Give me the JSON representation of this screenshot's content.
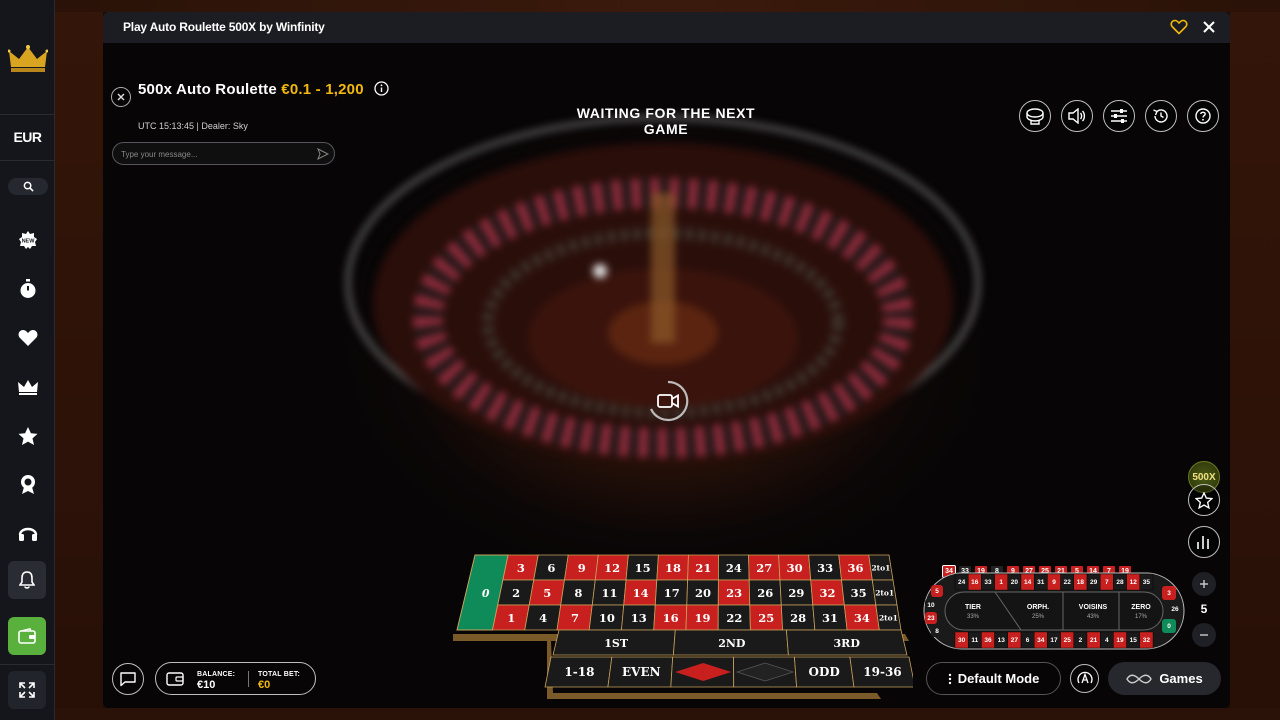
{
  "sidebar": {
    "currency": "EUR",
    "icons": [
      "crown-logo-icon",
      "search-icon",
      "new-games-icon",
      "stopwatch-icon",
      "heart-icon",
      "crown-icon",
      "star-icon",
      "trophy-icon",
      "headset-icon",
      "bell-icon",
      "wallet-icon",
      "fullscreen-icon"
    ]
  },
  "window": {
    "title": "Play Auto Roulette 500X by Winfinity"
  },
  "game": {
    "name": "500x Auto Roulette",
    "bet_limits": "€0.1 - 1,200",
    "meta": "UTC 15:13:45 | Dealer: Sky",
    "status": "WAITING FOR THE NEXT GAME"
  },
  "chat": {
    "placeholder": "Type your message..."
  },
  "multiplier_label": "500X",
  "recent_results": [
    {
      "n": "34",
      "c": "red"
    },
    {
      "n": "33",
      "c": "black"
    },
    {
      "n": "19",
      "c": "red"
    },
    {
      "n": "8",
      "c": "black"
    },
    {
      "n": "9",
      "c": "red"
    },
    {
      "n": "27",
      "c": "red"
    },
    {
      "n": "25",
      "c": "red"
    },
    {
      "n": "21",
      "c": "red"
    },
    {
      "n": "5",
      "c": "red"
    },
    {
      "n": "14",
      "c": "red"
    },
    {
      "n": "7",
      "c": "red"
    },
    {
      "n": "19",
      "c": "red"
    }
  ],
  "racetrack": {
    "top_row": [
      "24",
      "16",
      "33",
      "1",
      "20",
      "14",
      "31",
      "9",
      "22",
      "18",
      "29",
      "7",
      "28",
      "12",
      "35"
    ],
    "bottom_row": [
      "30",
      "11",
      "36",
      "13",
      "27",
      "6",
      "34",
      "17",
      "25",
      "2",
      "21",
      "4",
      "19",
      "15",
      "32"
    ],
    "left_col": [
      "5",
      "10",
      "23",
      "8"
    ],
    "right_col": [
      "3",
      "26",
      "0"
    ],
    "sections": [
      {
        "name": "TIER",
        "pct": "33%"
      },
      {
        "name": "ORPH.",
        "pct": "25%"
      },
      {
        "name": "VOISINS",
        "pct": "43%"
      },
      {
        "name": "ZERO",
        "pct": "17%"
      }
    ]
  },
  "chip_value": "5",
  "betting_table": {
    "zero": "0",
    "rows": [
      [
        "3",
        "6",
        "9",
        "12",
        "15",
        "18",
        "21",
        "24",
        "27",
        "30",
        "33",
        "36"
      ],
      [
        "2",
        "5",
        "8",
        "11",
        "14",
        "17",
        "20",
        "23",
        "26",
        "29",
        "32",
        "35"
      ],
      [
        "1",
        "4",
        "7",
        "10",
        "13",
        "16",
        "19",
        "22",
        "25",
        "28",
        "31",
        "34"
      ]
    ],
    "red_numbers": [
      "1",
      "3",
      "5",
      "7",
      "9",
      "12",
      "14",
      "16",
      "18",
      "19",
      "21",
      "23",
      "25",
      "27",
      "30",
      "32",
      "34",
      "36"
    ],
    "column_bet": "2to1",
    "dozens": [
      "1ST",
      "2ND",
      "3RD"
    ],
    "outside": [
      "1-18",
      "EVEN",
      "ODD",
      "19-36"
    ]
  },
  "balance": {
    "balance_label": "BALANCE:",
    "balance_value": "€10",
    "total_bet_label": "TOTAL BET:",
    "total_bet_value": "€0"
  },
  "buttons": {
    "mode": "Default Mode",
    "games": "Games"
  },
  "colors": {
    "accent_gold": "#f2b90c",
    "roulette_red": "#c8201e",
    "roulette_black": "#1a1a1a",
    "roulette_green": "#0f8a59",
    "wallet_green": "#5ab03d"
  }
}
